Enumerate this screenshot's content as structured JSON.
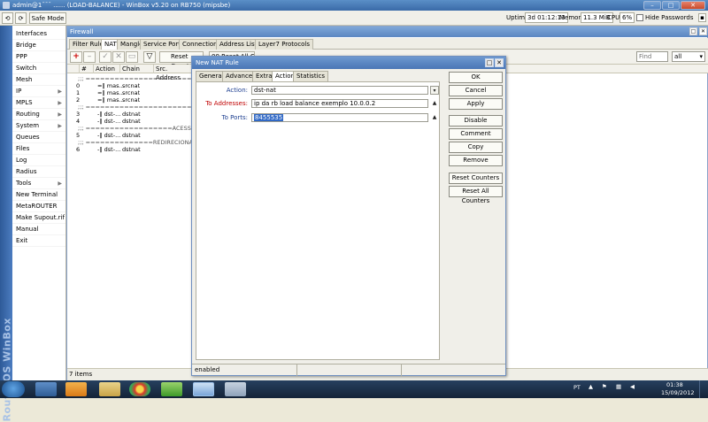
{
  "window": {
    "title": "admin@1¯¯¯ ...... (LOAD-BALANCE) - WinBox v5.20 on RB750 (mipsbe)"
  },
  "toolbar": {
    "undo": "⟲",
    "redo": "⟳",
    "safe_mode": "Safe Mode",
    "uptime_label": "Uptime:",
    "uptime_value": "3d 01:12:13",
    "memory_label": "Memory:",
    "memory_value": "11.3 MiB",
    "cpu_label": "CPU:",
    "cpu_value": "6%",
    "hide_passwords": "Hide Passwords"
  },
  "sidebar": {
    "brand": "RouterOS WinBox",
    "items": [
      {
        "label": "Interfaces",
        "submenu": false
      },
      {
        "label": "Bridge",
        "submenu": false
      },
      {
        "label": "PPP",
        "submenu": false
      },
      {
        "label": "Switch",
        "submenu": false
      },
      {
        "label": "Mesh",
        "submenu": false
      },
      {
        "label": "IP",
        "submenu": true
      },
      {
        "label": "MPLS",
        "submenu": true
      },
      {
        "label": "Routing",
        "submenu": true
      },
      {
        "label": "System",
        "submenu": true
      },
      {
        "label": "Queues",
        "submenu": false
      },
      {
        "label": "Files",
        "submenu": false
      },
      {
        "label": "Log",
        "submenu": false
      },
      {
        "label": "Radius",
        "submenu": false
      },
      {
        "label": "Tools",
        "submenu": true
      },
      {
        "label": "New Terminal",
        "submenu": false
      },
      {
        "label": "MetaROUTER",
        "submenu": false
      },
      {
        "label": "Make Supout.rif",
        "submenu": false
      },
      {
        "label": "Manual",
        "submenu": false
      },
      {
        "label": "Exit",
        "submenu": false
      }
    ]
  },
  "firewall": {
    "title": "Firewall",
    "tabs": [
      "Filter Rules",
      "NAT",
      "Mangle",
      "Service Ports",
      "Connections",
      "Address Lists",
      "Layer7 Protocols"
    ],
    "active_tab": "NAT",
    "reset_counters": "Reset Counters",
    "reset_all_counters": "00 Reset All Counters",
    "find_placeholder": "Find",
    "filter_value": "all",
    "columns": [
      "#",
      "Action",
      "Chain",
      "Src. Address"
    ],
    "rows": [
      {
        "num": "",
        "action": ";;; ===============================================",
        "chain": ""
      },
      {
        "num": "0",
        "action": "=‖ mas...",
        "chain": "srcnat"
      },
      {
        "num": "1",
        "action": "=‖ mas...",
        "chain": "srcnat"
      },
      {
        "num": "2",
        "action": "=‖ mas...",
        "chain": "srcnat"
      },
      {
        "num": "",
        "action": ";;; ================================ACESSO CA",
        "chain": ""
      },
      {
        "num": "3",
        "action": "-‖ dst-...",
        "chain": "dstnat"
      },
      {
        "num": "4",
        "action": "-‖ dst-...",
        "chain": "dstnat"
      },
      {
        "num": "",
        "action": ";;; ==================ACESSO UVN_ WBR T",
        "chain": ""
      },
      {
        "num": "5",
        "action": "-‖ dst-...",
        "chain": "dstnat"
      },
      {
        "num": "",
        "action": ";;; ==============REDIRECIONA IP VALIDO",
        "chain": ""
      },
      {
        "num": "6",
        "action": "-‖ dst-...",
        "chain": "dstnat"
      }
    ],
    "status": "7 items"
  },
  "dialog": {
    "title": "New NAT Rule",
    "tabs": [
      "General",
      "Advanced",
      "Extra",
      "Action",
      "Statistics"
    ],
    "active_tab": "Action",
    "action_label": "Action:",
    "action_value": "dst-nat",
    "to_addresses_label": "To Addresses:",
    "to_addresses_value": "ip da rb load balance exemplo 10.0.0.2",
    "to_ports_label": "To Ports:",
    "to_ports_value": "8455535",
    "buttons": [
      "OK",
      "Cancel",
      "Apply",
      "Disable",
      "Comment",
      "Copy",
      "Remove",
      "Reset Counters",
      "Reset All Counters"
    ],
    "status": "enabled"
  },
  "taskbar": {
    "lang": "PT",
    "time": "01:38",
    "date": "15/09/2012"
  },
  "colors": {
    "titlebar": "#3a6aa8",
    "label_red": "#c00000",
    "label_blue": "#1b3d8f",
    "selection": "#3169c6"
  }
}
